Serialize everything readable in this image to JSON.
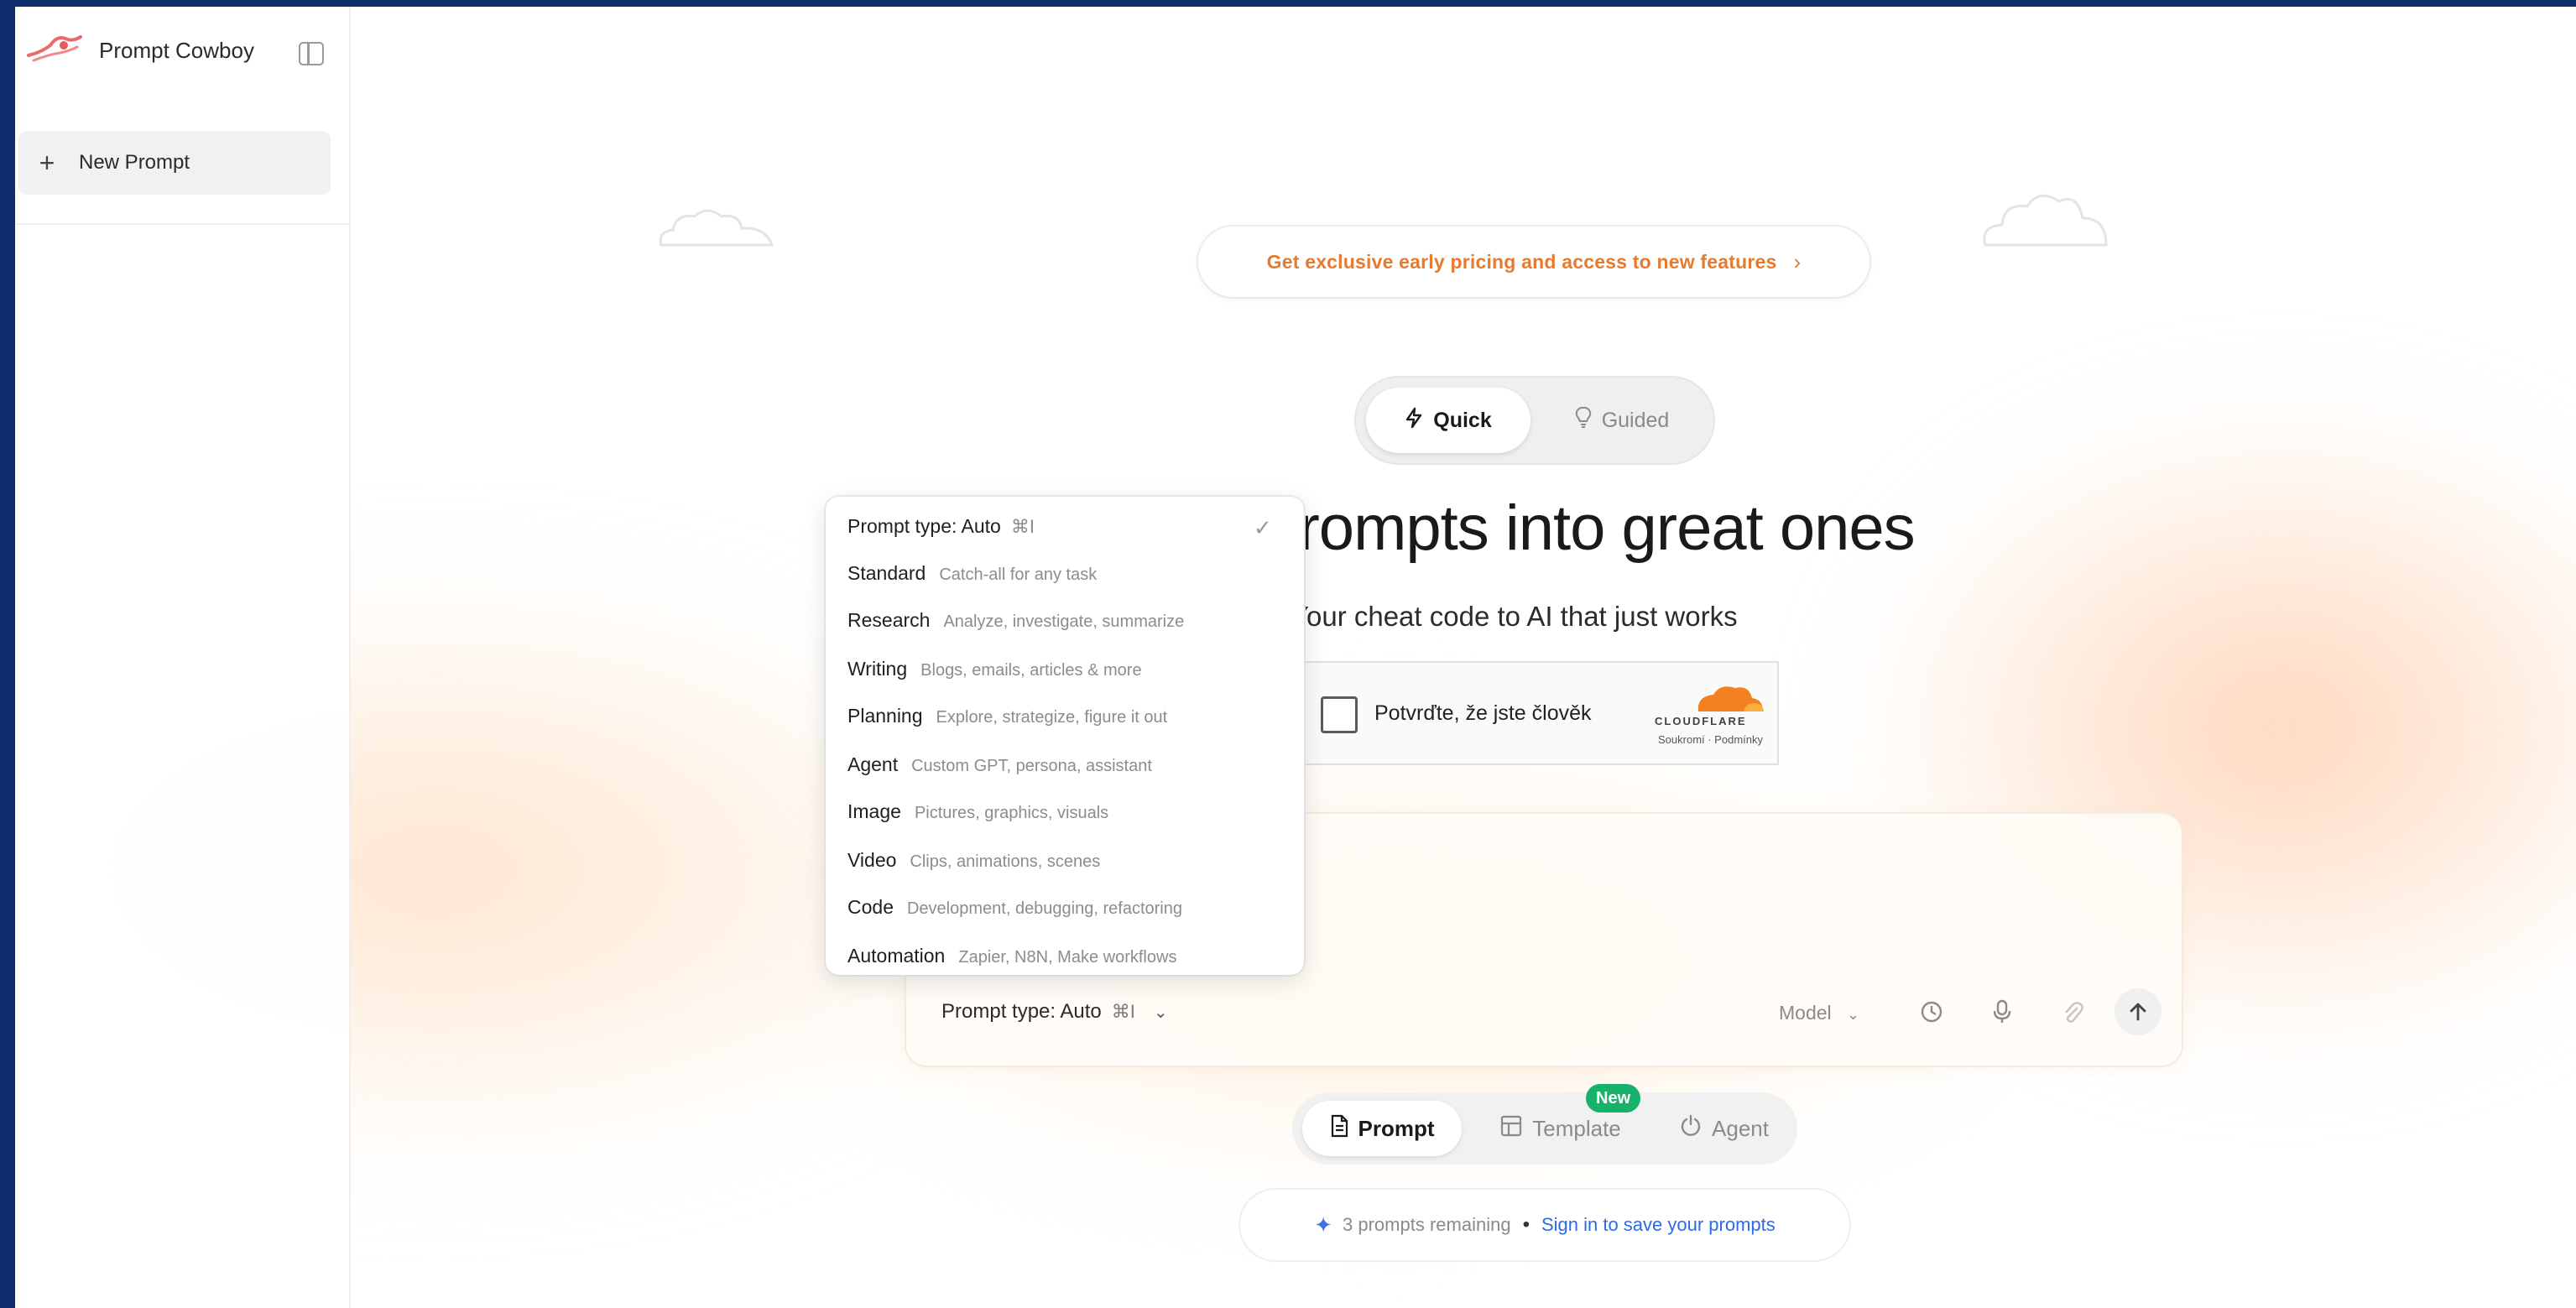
{
  "sidebar": {
    "app_name": "Prompt Cowboy",
    "new_prompt_label": "New Prompt"
  },
  "banner": {
    "text": "Get exclusive early pricing and access to new features"
  },
  "mode_toggle": {
    "quick_label": "Quick",
    "guided_label": "Guided",
    "active": "Quick"
  },
  "hero": {
    "headline_visible": "/ prompts into great ones",
    "subline_visible": "Your cheat code to AI that just works"
  },
  "captcha": {
    "label": "Potvrďte, že jste člověk",
    "brand": "CLOUDFLARE",
    "links": "Soukromí · Podmínky"
  },
  "dropdown": {
    "header": "Prompt type: Auto",
    "header_shortcut": "⌘I",
    "items": [
      {
        "name": "Standard",
        "desc": "Catch-all for any task"
      },
      {
        "name": "Research",
        "desc": "Analyze, investigate, summarize"
      },
      {
        "name": "Writing",
        "desc": "Blogs, emails, articles & more"
      },
      {
        "name": "Planning",
        "desc": "Explore, strategize, figure it out"
      },
      {
        "name": "Agent",
        "desc": "Custom GPT, persona, assistant"
      },
      {
        "name": "Image",
        "desc": "Pictures, graphics, visuals"
      },
      {
        "name": "Video",
        "desc": "Clips, animations, scenes"
      },
      {
        "name": "Code",
        "desc": "Development, debugging, refactoring"
      },
      {
        "name": "Automation",
        "desc": "Zapier, N8N, Make workflows"
      }
    ]
  },
  "prompt_card": {
    "prompt_type_label": "Prompt type: Auto",
    "shortcut": "⌘I",
    "model_label": "Model"
  },
  "bottom_tabs": {
    "prompt_label": "Prompt",
    "template_label": "Template",
    "agent_label": "Agent",
    "new_badge": "New",
    "active": "Prompt"
  },
  "footer": {
    "remaining_text": "3 prompts remaining",
    "signin_text": "Sign in to save your prompts"
  },
  "colors": {
    "accent_orange": "#e67a2e",
    "badge_green": "#17b26a",
    "link_blue": "#2d6be0",
    "frame_border": "#0d2c6b"
  },
  "icons": [
    "cowboy-logo-icon",
    "sidebar-toggle-icon",
    "plus-icon",
    "chevron-right-icon",
    "bolt-icon",
    "lightbulb-icon",
    "check-icon",
    "cloudflare-icon",
    "chevron-down-icon",
    "history-icon",
    "microphone-icon",
    "paperclip-icon",
    "arrow-up-icon",
    "document-icon",
    "template-icon",
    "agent-icon",
    "sparkle-icon"
  ]
}
